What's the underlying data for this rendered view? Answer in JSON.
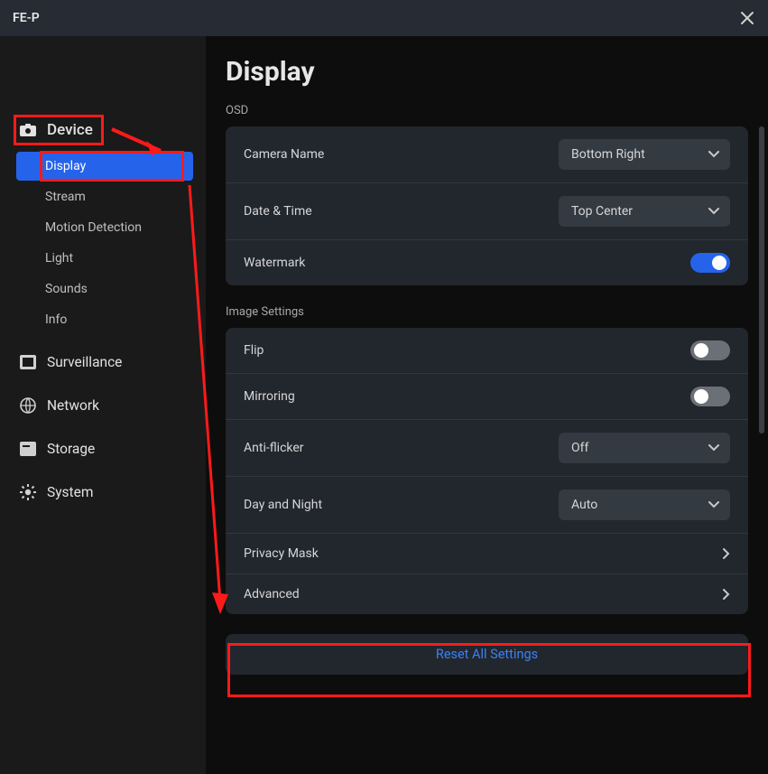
{
  "window": {
    "title": "FE-P"
  },
  "sidebar": {
    "device_label": "Device",
    "subitems": [
      {
        "label": "Display",
        "active": true
      },
      {
        "label": "Stream",
        "active": false
      },
      {
        "label": "Motion Detection",
        "active": false
      },
      {
        "label": "Light",
        "active": false
      },
      {
        "label": "Sounds",
        "active": false
      },
      {
        "label": "Info",
        "active": false
      }
    ],
    "cats": [
      {
        "label": "Surveillance",
        "icon": "surveillance"
      },
      {
        "label": "Network",
        "icon": "globe"
      },
      {
        "label": "Storage",
        "icon": "storage"
      },
      {
        "label": "System",
        "icon": "gear"
      }
    ]
  },
  "page": {
    "title": "Display",
    "osd": {
      "label": "OSD",
      "camera_name": {
        "label": "Camera Name",
        "value": "Bottom Right"
      },
      "date_time": {
        "label": "Date & Time",
        "value": "Top Center"
      },
      "watermark": {
        "label": "Watermark",
        "value": true
      }
    },
    "image_settings": {
      "label": "Image Settings",
      "flip": {
        "label": "Flip",
        "value": false
      },
      "mirroring": {
        "label": "Mirroring",
        "value": false
      },
      "anti_flicker": {
        "label": "Anti-flicker",
        "value": "Off"
      },
      "day_night": {
        "label": "Day and Night",
        "value": "Auto"
      },
      "privacy_mask": {
        "label": "Privacy Mask"
      },
      "advanced": {
        "label": "Advanced"
      }
    },
    "reset_label": "Reset All Settings"
  },
  "annotations": {
    "highlight_device": true,
    "highlight_display": true,
    "highlight_advanced": true,
    "arrow": true
  }
}
